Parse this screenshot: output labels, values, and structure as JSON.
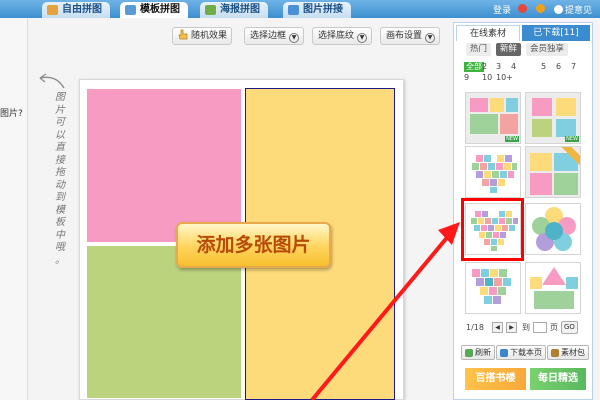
{
  "tabs": [
    {
      "label": "自由拼图",
      "icon": "puzzle-icon",
      "active": false
    },
    {
      "label": "模板拼图",
      "icon": "template-icon",
      "active": true
    },
    {
      "label": "海报拼图",
      "icon": "poster-icon",
      "active": false
    },
    {
      "label": "图片拼接",
      "icon": "stitch-icon",
      "active": false
    }
  ],
  "top_links": {
    "login": "登录",
    "feedback": "提意见"
  },
  "left_fragment": "图片?",
  "toolbar": {
    "random": "随机效果",
    "border": "选择边框",
    "texture": "选择底纹",
    "canvas": "画布设置"
  },
  "hint_text": [
    "图",
    "片",
    "可",
    "以",
    "直",
    "接",
    "拖",
    "动",
    "到",
    "模",
    "板",
    "中",
    "哦",
    "。"
  ],
  "add_button": "添加多张图片",
  "panel": {
    "tab_online": "在线素材",
    "tab_downloaded": "已下载[11]",
    "filters": [
      "热门",
      "新鲜",
      "会员独享"
    ],
    "counts_all": "全部",
    "counts_row1": [
      "2",
      "3",
      "4",
      "5",
      "6",
      "7",
      "8"
    ],
    "counts_row2": [
      "9",
      "10",
      "10+"
    ],
    "new_badge": "NEW",
    "pager_text": "1/18",
    "pager_to": "到",
    "pager_page": "页",
    "go": "GO",
    "refresh": "刷新",
    "download_page": "下载本页",
    "material_pack": "素材包",
    "banner1": "百搭书楼",
    "banner2": "每日精选"
  },
  "colors": {
    "pink": "#f79bc2",
    "green": "#bcd37e",
    "yellow": "#fedb7a",
    "highlight_red": "#ff0000",
    "tab_blue": "#3b8bd1"
  }
}
